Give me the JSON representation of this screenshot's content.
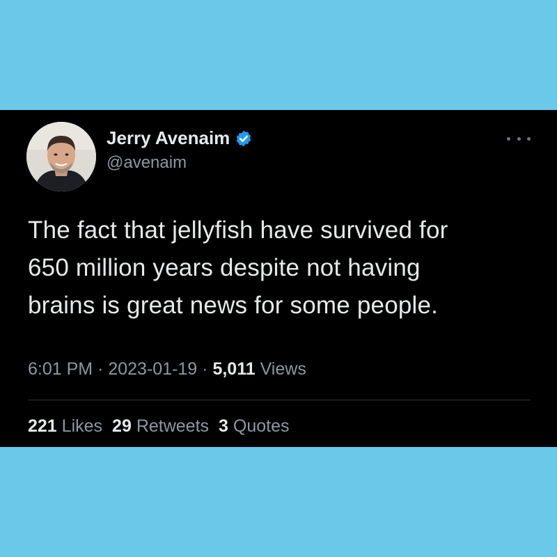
{
  "author": {
    "display_name": "Jerry Avenaim",
    "handle": "@avenaim",
    "verified": true
  },
  "tweet": {
    "lines": [
      "The fact that jellyfish have survived for",
      "650 million years despite not having",
      "brains is great news for some people."
    ],
    "time": "6:01 PM",
    "date": "2023-01-19",
    "separator": " · ",
    "views_count": "5,011",
    "views_label": "Views"
  },
  "stats": {
    "likes_count": "221",
    "likes_label": "Likes",
    "retweets_count": "29",
    "retweets_label": "Retweets",
    "quotes_count": "3",
    "quotes_label": "Quotes"
  },
  "icons": {
    "verified": "verified-badge-icon",
    "more": "more-options-icon"
  },
  "colors": {
    "background": "#6ac8e8",
    "card": "#000000",
    "text_primary": "#e7e9ea",
    "text_secondary": "#8b98a5",
    "verified_blue": "#1d9bf0",
    "divider": "#2f3336"
  }
}
